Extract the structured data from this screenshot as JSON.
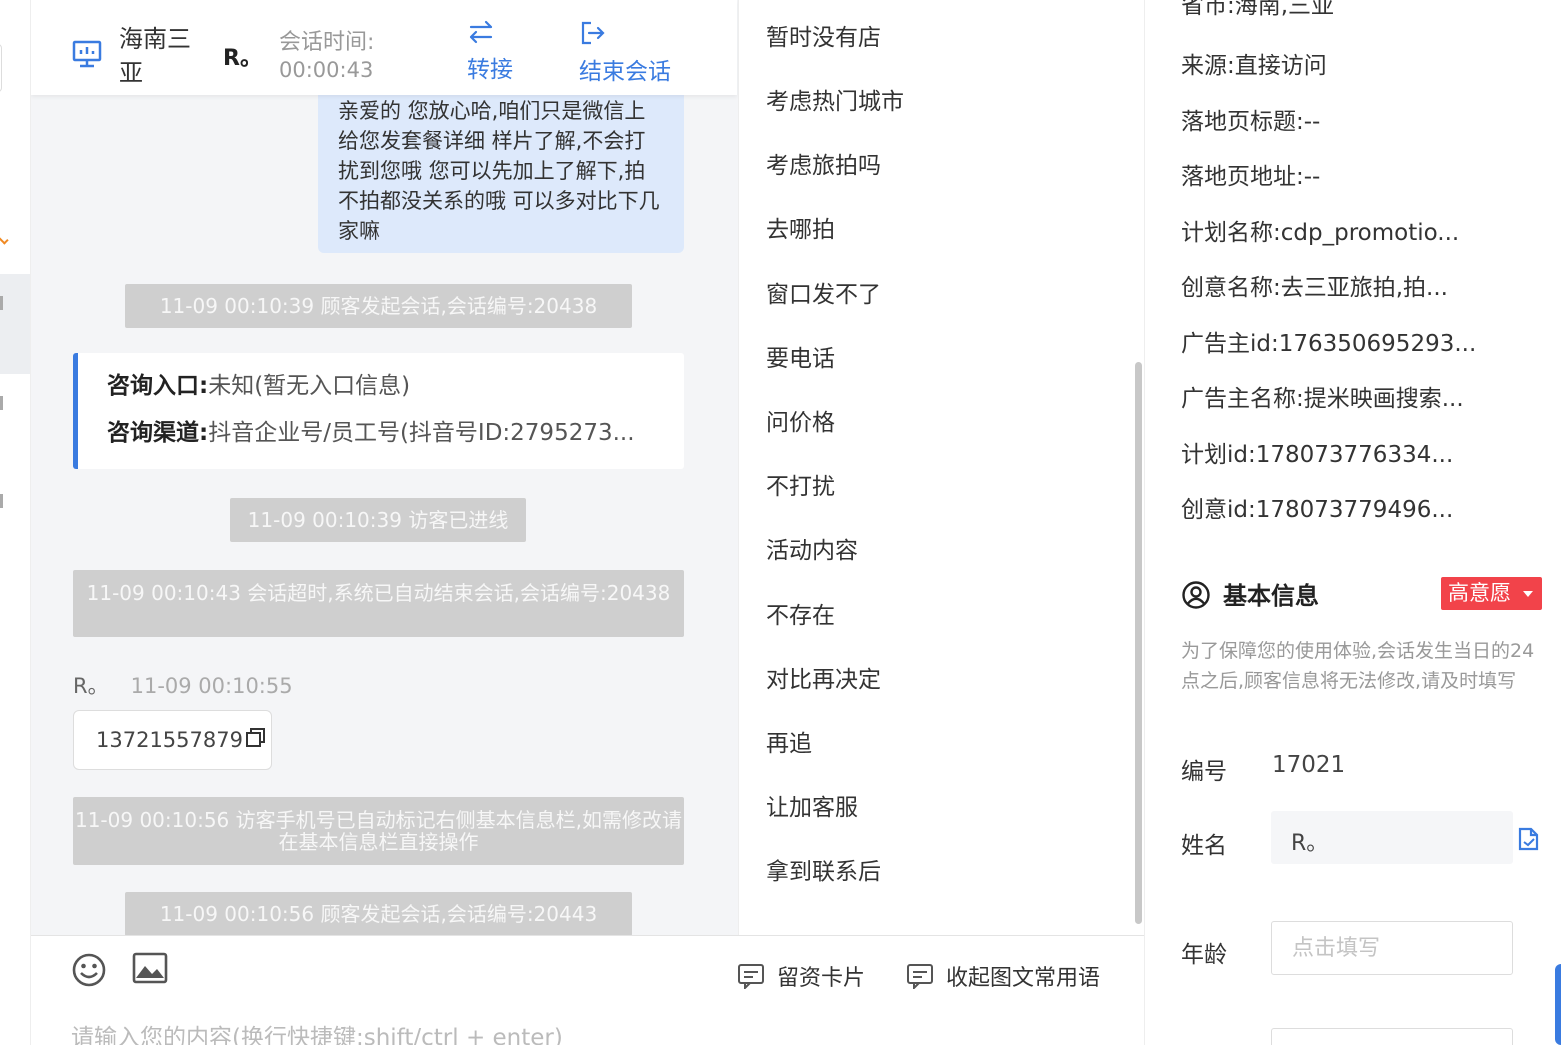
{
  "header": {
    "region": "海南三亚",
    "visitor_name": "R。",
    "session_time_label": "会话时间:",
    "session_time": "00:00:43",
    "transfer_label": "转接",
    "end_session_label": "结束会话"
  },
  "chat": {
    "agent_message": "亲爱的 您放心哈,咱们只是微信上给您发套餐详细 样片了解,不会打扰到您哦 您可以先加上了解下,拍不拍都没关系的哦 可以多对比下几家嘛",
    "system_1": "11-09 00:10:39 顾客发起会话,会话编号:20438",
    "consult_entry_label": "咨询入口:",
    "consult_entry_value": "未知(暂无入口信息)",
    "consult_channel_label": "咨询渠道:",
    "consult_channel_value": "抖音企业号/员工号(抖音号ID:2795273...",
    "system_2": "11-09 00:10:39 访客已进线",
    "system_3": "11-09 00:10:43 会话超时,系统已自动结束会话,会话编号:20438",
    "visitor_sender": "R。",
    "visitor_time": "11-09 00:10:55",
    "visitor_phone": "13721557879",
    "system_4": "11-09 00:10:56 访客手机号已自动标记右侧基本信息栏,如需修改请在基本信息栏直接操作",
    "system_5": "11-09 00:10:56 顾客发起会话,会话编号:20443"
  },
  "input": {
    "card_label": "留资卡片",
    "collapse_label": "收起图文常用语",
    "placeholder": "请输入您的内容(换行快捷键:shift/ctrl + enter)"
  },
  "quick_replies": [
    "暂时没有店",
    "考虑热门城市",
    "考虑旅拍吗",
    "去哪拍",
    "窗口发不了",
    "要电话",
    "问价格",
    "不打扰",
    "活动内容",
    "不存在",
    "对比再决定",
    "再追",
    "让加客服",
    "拿到联系后"
  ],
  "info": {
    "cut_off_top": "省市:海南,三亚",
    "source": "来源:直接访问",
    "landing_title": "落地页标题:--",
    "landing_url": "落地页地址:--",
    "plan_name": "计划名称:cdp_promotio...",
    "creative_name": "创意名称:去三亚旅拍,拍...",
    "advertiser_id": "广告主id:176350695293...",
    "advertiser_name": "广告主名称:提米映画搜索...",
    "plan_id": "计划id:178073776334...",
    "creative_id": "创意id:178073779496...",
    "basic_info_title": "基本信息",
    "intent_badge": "高意愿",
    "note": "为了保障您的使用体验,会话发生当日的24点之后,顾客信息将无法修改,请及时填写",
    "id_label": "编号",
    "id_value": "17021",
    "name_label": "姓名",
    "name_value": "R。",
    "age_label": "年龄",
    "age_placeholder": "点击填写"
  },
  "colors": {
    "accent": "#3a7be0",
    "badge": "#f2434a",
    "agent_bubble": "#dde9fb",
    "system_message": "#cfcfcf"
  },
  "icons": [
    "monitor-icon",
    "transfer-icon",
    "exit-icon",
    "copy-icon",
    "emoji-icon",
    "image-icon",
    "card-icon",
    "message-icon",
    "user-circle-icon",
    "document-icon"
  ]
}
